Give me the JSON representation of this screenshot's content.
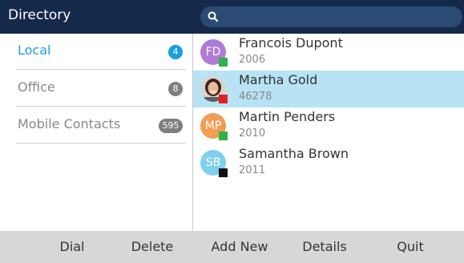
{
  "header": {
    "title": "Directory",
    "search": {
      "placeholder": "",
      "icon": "search-icon"
    }
  },
  "sidebar": {
    "items": [
      {
        "label": "Local",
        "count": "4",
        "badge_color": "#1a9fe0",
        "label_color": "#1a9fe0",
        "selected": true
      },
      {
        "label": "Office",
        "count": "8",
        "badge_color": "#7f7f7f",
        "label_color": "#888888",
        "selected": false
      },
      {
        "label": "Mobile Contacts",
        "count": "595",
        "badge_color": "#7f7f7f",
        "label_color": "#888888",
        "selected": false
      }
    ]
  },
  "contacts": [
    {
      "initials": "FD",
      "name": "Francois Dupont",
      "ext": "2006",
      "avatar_color": "#b07bd6",
      "status_color": "#2fb24a",
      "selected": false,
      "photo": false
    },
    {
      "initials": "",
      "name": "Martha Gold",
      "ext": "46278",
      "avatar_color": "#cfcfcf",
      "status_color": "#e02020",
      "selected": true,
      "photo": true
    },
    {
      "initials": "MP",
      "name": "Martin Penders",
      "ext": "2010",
      "avatar_color": "#f19d53",
      "status_color": "#2fb24a",
      "selected": false,
      "photo": false
    },
    {
      "initials": "SB",
      "name": "Samantha Brown",
      "ext": "2011",
      "avatar_color": "#7fcfee",
      "status_color": "#111111",
      "selected": false,
      "photo": false
    }
  ],
  "softkeys": [
    {
      "label": "Dial"
    },
    {
      "label": "Delete"
    },
    {
      "label": "Add New"
    },
    {
      "label": "Details"
    },
    {
      "label": "Quit"
    }
  ],
  "colors": {
    "header_bg": "#15294a",
    "search_bg": "#2b4a74",
    "selection": "#b7e3f5",
    "softkey_bar": "#d7d7d7"
  }
}
